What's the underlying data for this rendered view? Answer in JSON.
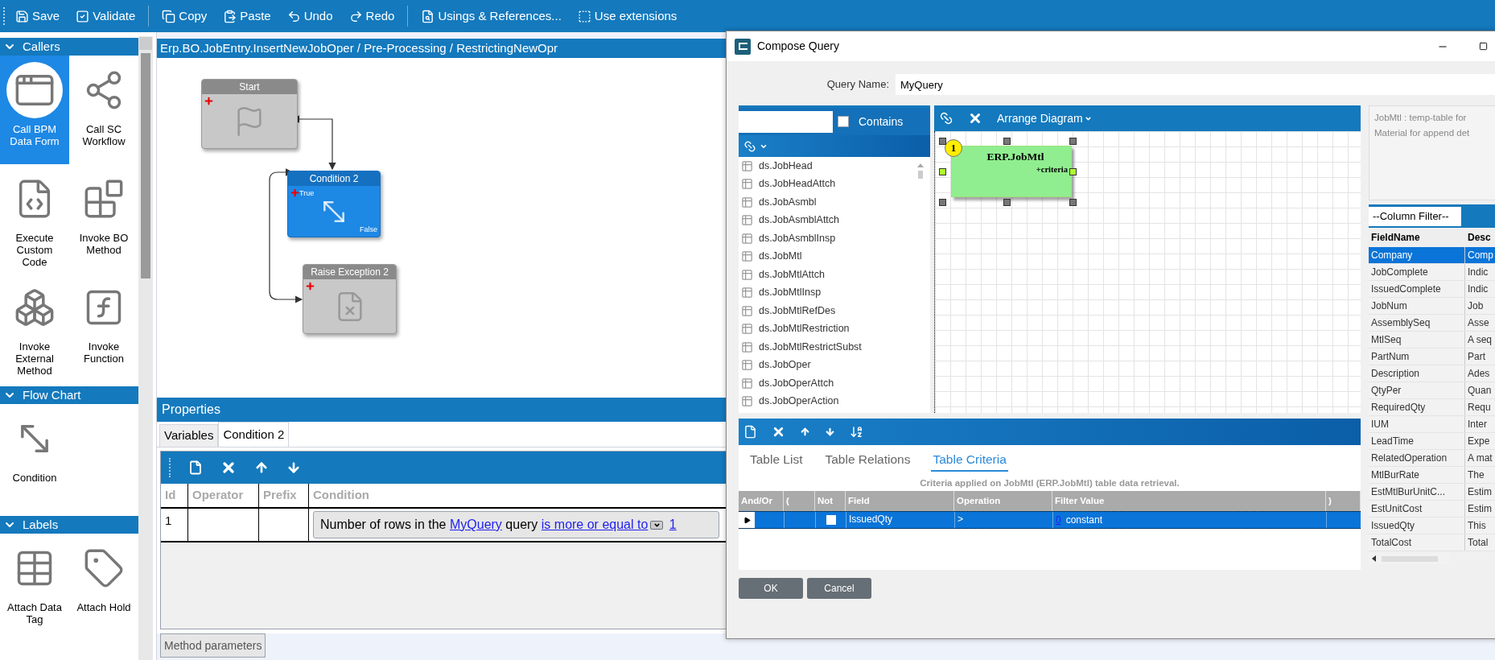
{
  "toolbar": [
    {
      "label": "Save"
    },
    {
      "label": "Validate"
    },
    {
      "label": "Copy"
    },
    {
      "label": "Paste"
    },
    {
      "label": "Undo"
    },
    {
      "label": "Redo"
    },
    {
      "label": "Usings & References..."
    },
    {
      "label": "Use extensions"
    }
  ],
  "palette": {
    "sections": [
      {
        "title": "Callers",
        "expanded": true,
        "items": [
          {
            "label": "Call BPM Data Form",
            "selected": true
          },
          {
            "label": "Call SC Workflow",
            "selected": false
          },
          {
            "label": "Execute Custom Code",
            "selected": false
          },
          {
            "label": "Invoke BO Method",
            "selected": false
          },
          {
            "label": "Invoke External Method",
            "selected": false
          },
          {
            "label": "Invoke Function",
            "selected": false
          }
        ]
      },
      {
        "title": "Flow Chart",
        "expanded": true,
        "items": [
          {
            "label": "Condition",
            "selected": false
          }
        ]
      },
      {
        "title": "Labels",
        "expanded": true,
        "items": [
          {
            "label": "Attach Data Tag",
            "selected": false
          },
          {
            "label": "Attach Hold",
            "selected": false
          }
        ]
      }
    ]
  },
  "breadcrumb": "Erp.BO.JobEntry.InsertNewJobOper / Pre-Processing / RestrictingNewOpr",
  "diagram": {
    "nodes": [
      {
        "kind": "start",
        "title": "Start",
        "selected": false
      },
      {
        "kind": "condition",
        "title": "Condition 2",
        "selected": true,
        "true_label": "True",
        "false_label": "False"
      },
      {
        "kind": "exception",
        "title": "Raise Exception 2",
        "selected": false
      }
    ]
  },
  "properties": {
    "title": "Properties",
    "tabs": [
      {
        "label": "Variables",
        "selected": false
      },
      {
        "label": "Condition 2",
        "selected": true
      }
    ],
    "columns": [
      "Id",
      "Operator",
      "Prefix",
      "Condition"
    ],
    "rows": [
      {
        "id": "1",
        "condition": {
          "text_1": "Number of rows in the",
          "query_link": "MyQuery",
          "text_2": "query",
          "operator_link": "is more or equal to",
          "value_link": "1"
        }
      }
    ]
  },
  "bottom_tab": "Method parameters",
  "dialog": {
    "title": "Compose Query",
    "query_name_label": "Query Name:",
    "query_name": "MyQuery",
    "contains_label": "Contains",
    "contains_checked": false,
    "tables": [
      {
        "name": "ds.JobHead"
      },
      {
        "name": "ds.JobHeadAttch"
      },
      {
        "name": "ds.JobAsmbl"
      },
      {
        "name": "ds.JobAsmblAttch"
      },
      {
        "name": "ds.JobAsmblInsp"
      },
      {
        "name": "ds.JobMtl"
      },
      {
        "name": "ds.JobMtlAttch"
      },
      {
        "name": "ds.JobMtlInsp"
      },
      {
        "name": "ds.JobMtlRefDes"
      },
      {
        "name": "ds.JobMtlRestriction"
      },
      {
        "name": "ds.JobMtlRestrictSubst"
      },
      {
        "name": "ds.JobOper"
      },
      {
        "name": "ds.JobOperAttch"
      },
      {
        "name": "ds.JobOperAction"
      }
    ],
    "arrange_label": "Arrange Diagram",
    "query_table": {
      "number": "1",
      "name": "ERP.JobMtl",
      "note": "+criteria"
    },
    "tabs": [
      {
        "label": "Table List",
        "selected": false
      },
      {
        "label": "Table Relations",
        "selected": false
      },
      {
        "label": "Table Criteria",
        "selected": true
      }
    ],
    "criteria_caption": "Criteria applied on JobMtl (ERP.JobMtl)  table data retrieval.",
    "criteria_columns": [
      "And/Or",
      "(",
      "Not",
      "Field",
      "Operation",
      "Filter Value",
      ")"
    ],
    "criteria_rows": [
      {
        "selected": true,
        "not_checked": false,
        "field": "IssuedQty",
        "operation": ">",
        "value_link": "0",
        "value_type": "constant"
      }
    ],
    "description": [
      "JobMtl : temp-table for",
      "Material for append det"
    ],
    "column_filter": "--Column Filter--",
    "field_columns": [
      "FieldName",
      "Desc"
    ],
    "fields": [
      {
        "name": "Company",
        "desc": "Comp",
        "selected": true
      },
      {
        "name": "JobComplete",
        "desc": "Indic",
        "selected": false
      },
      {
        "name": "IssuedComplete",
        "desc": "Indic",
        "selected": false
      },
      {
        "name": "JobNum",
        "desc": "Job",
        "selected": false
      },
      {
        "name": "AssemblySeq",
        "desc": "Asse",
        "selected": false
      },
      {
        "name": "MtlSeq",
        "desc": "A seq",
        "selected": false
      },
      {
        "name": "PartNum",
        "desc": "Part",
        "selected": false
      },
      {
        "name": "Description",
        "desc": "Ades",
        "selected": false
      },
      {
        "name": "QtyPer",
        "desc": "Quan",
        "selected": false
      },
      {
        "name": "RequiredQty",
        "desc": "Requ",
        "selected": false
      },
      {
        "name": "IUM",
        "desc": "Inter",
        "selected": false
      },
      {
        "name": "LeadTime",
        "desc": "Expe",
        "selected": false
      },
      {
        "name": "RelatedOperation",
        "desc": "A mat",
        "selected": false
      },
      {
        "name": "MtlBurRate",
        "desc": "The",
        "selected": false
      },
      {
        "name": "EstMtlBurUnitC...",
        "desc": "Estim",
        "selected": false
      },
      {
        "name": "EstUnitCost",
        "desc": "Estim",
        "selected": false
      },
      {
        "name": "IssuedQty",
        "desc": "This",
        "selected": false
      },
      {
        "name": "TotalCost",
        "desc": "Total",
        "selected": false
      }
    ],
    "buttons": [
      {
        "label": "OK"
      },
      {
        "label": "Cancel"
      }
    ]
  }
}
